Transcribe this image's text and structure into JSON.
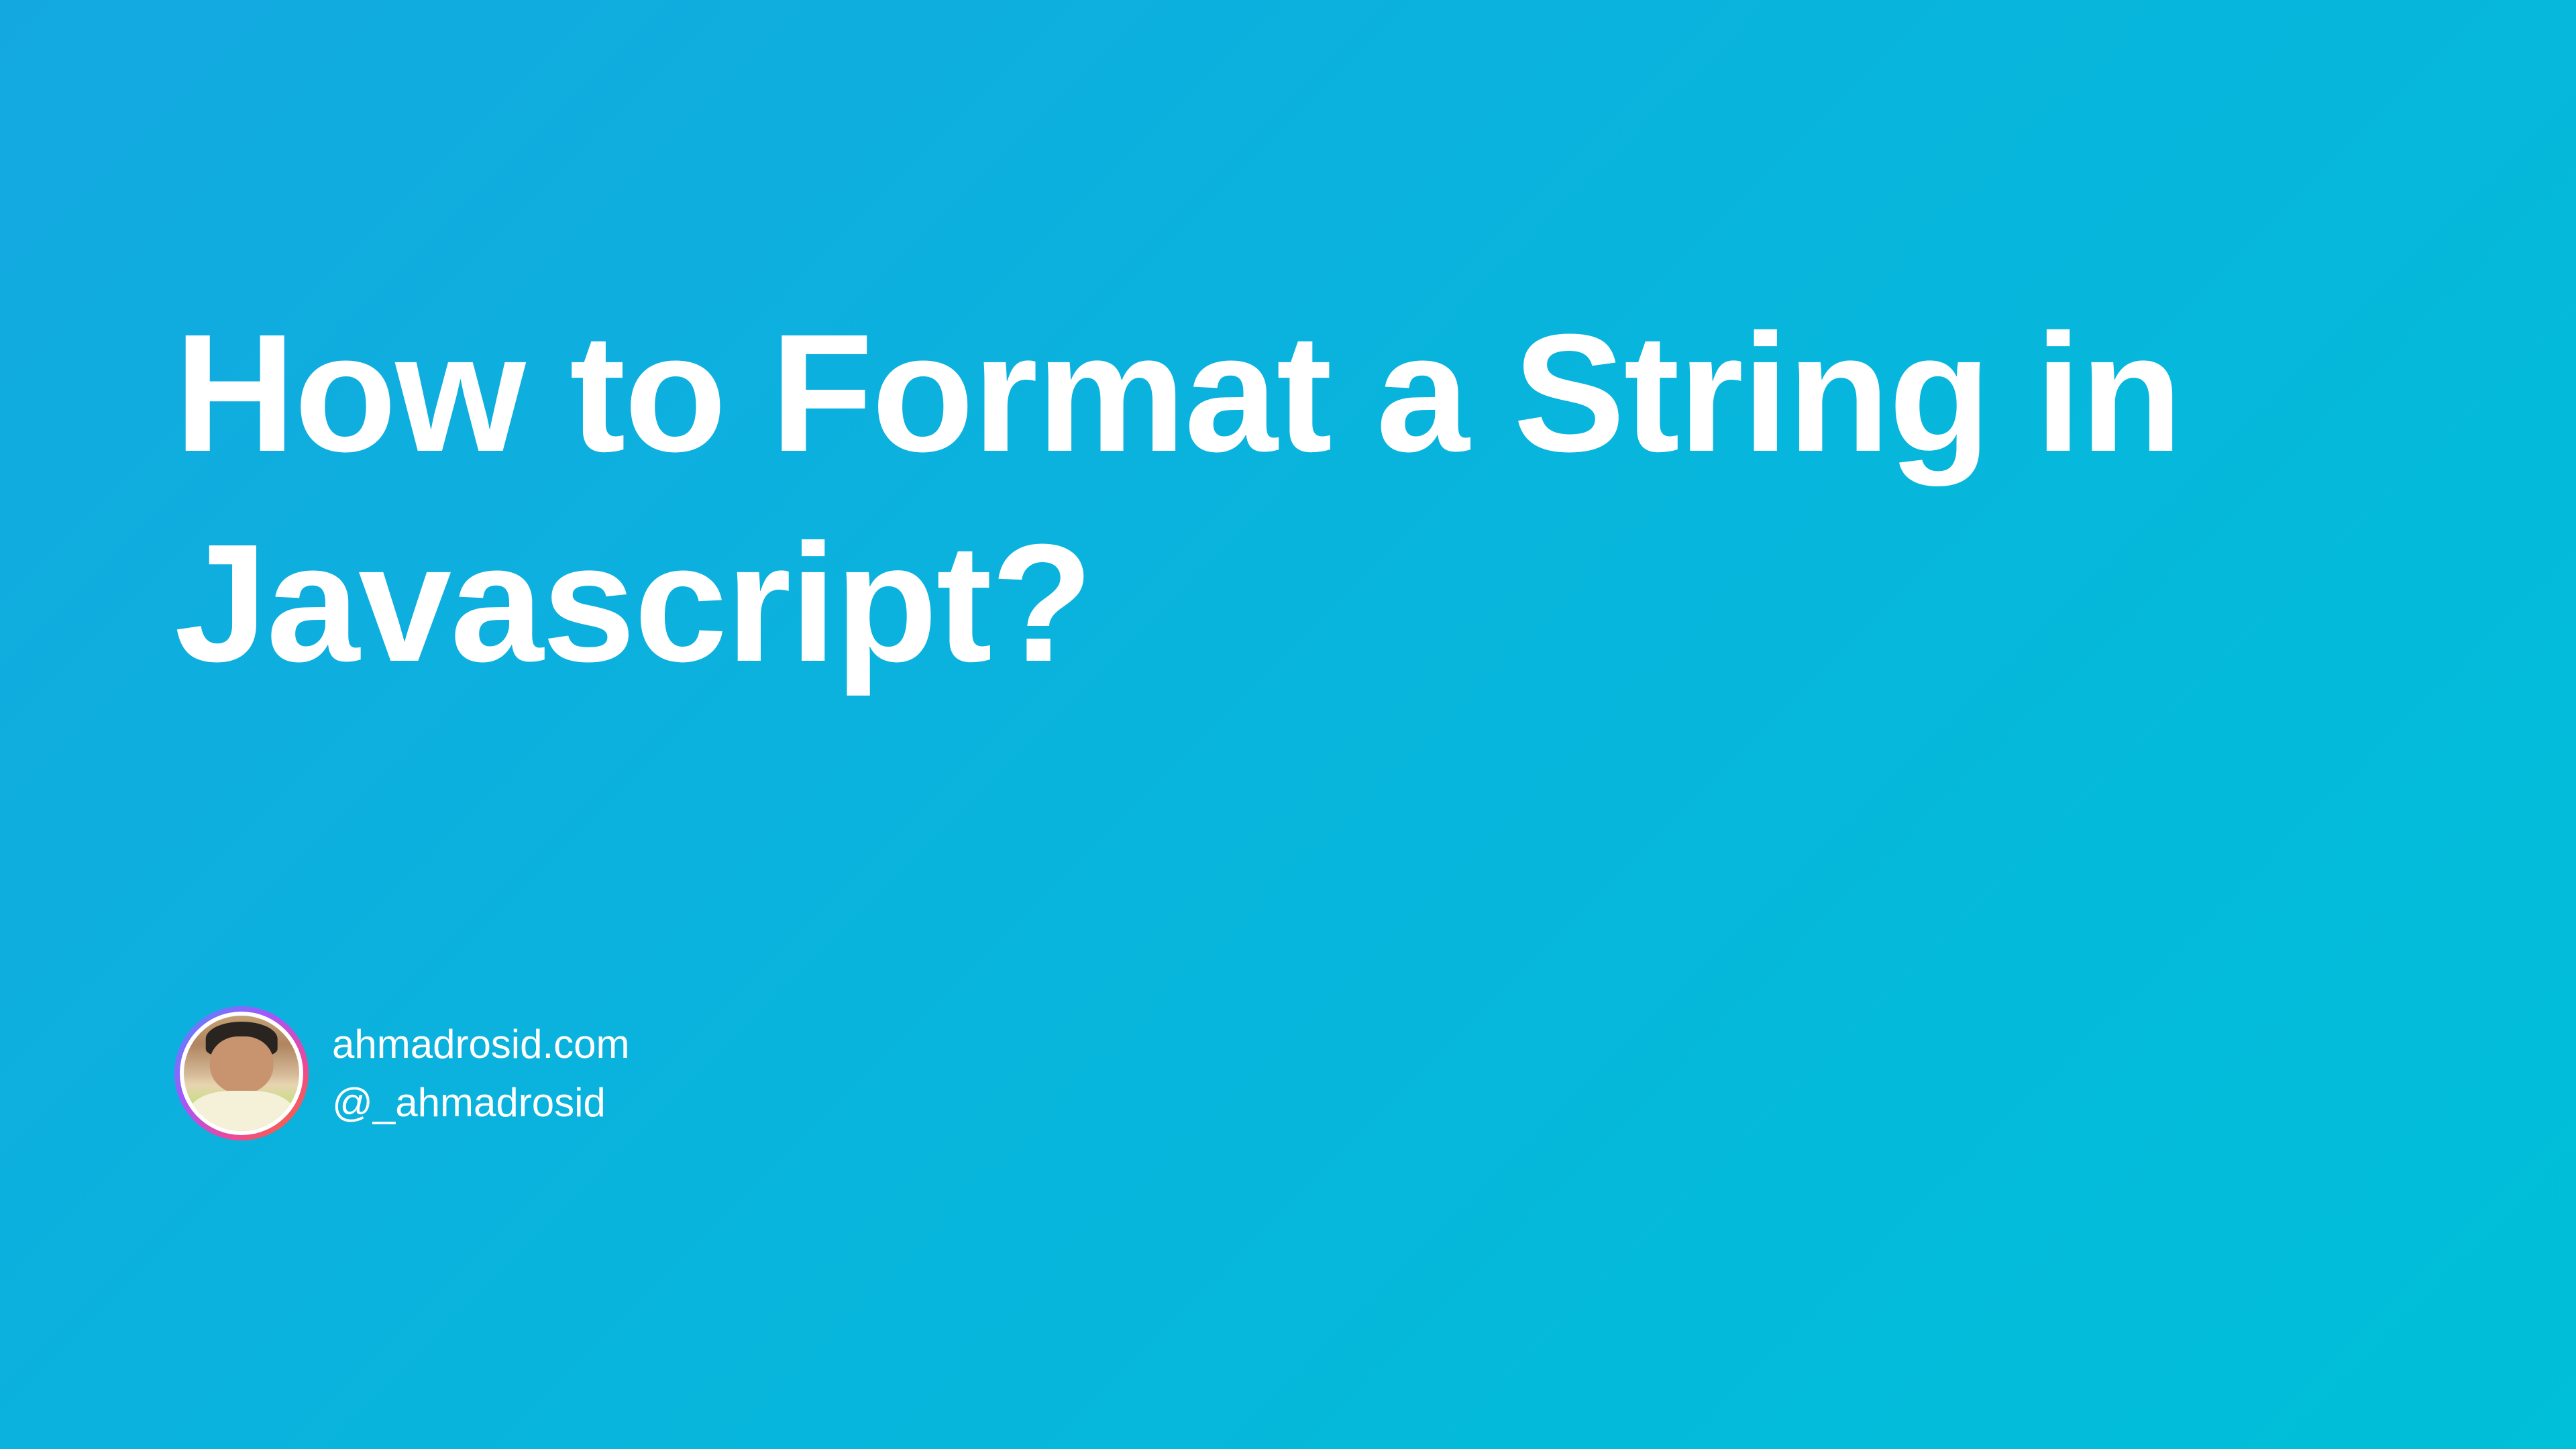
{
  "title": "How to Format a String in Javascript?",
  "author": {
    "website": "ahmadrosid.com",
    "handle": "@_ahmadrosid"
  }
}
